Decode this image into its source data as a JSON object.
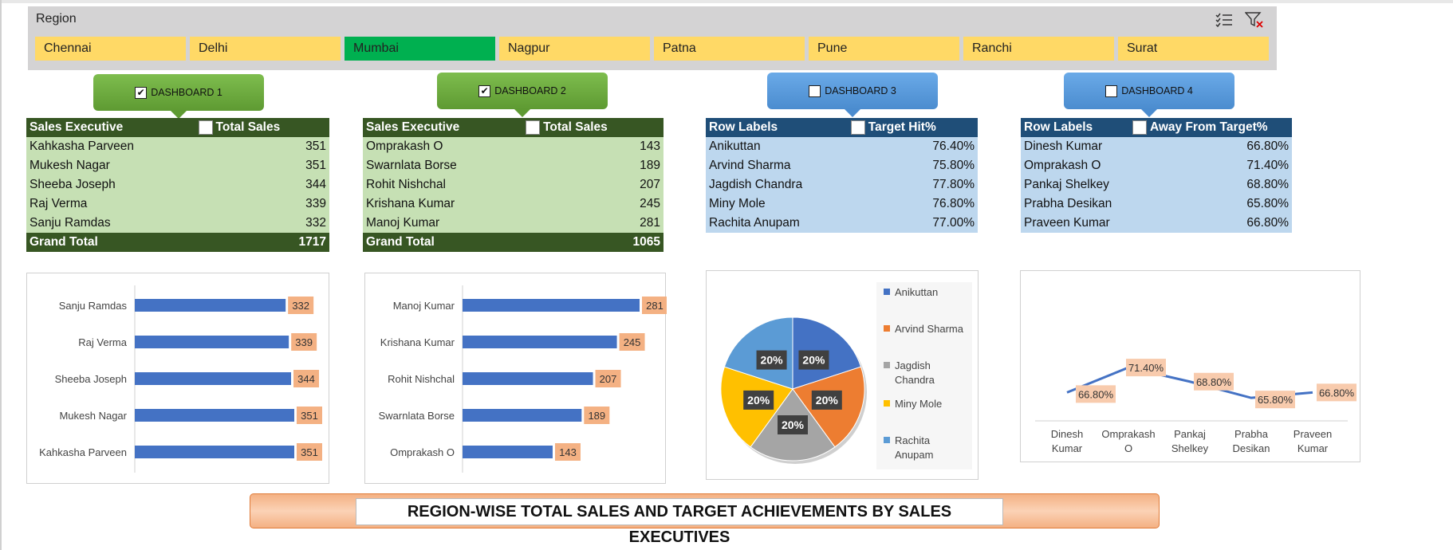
{
  "slicer": {
    "title": "Region",
    "items": [
      "Chennai",
      "Delhi",
      "Mumbai",
      "Nagpur",
      "Patna",
      "Pune",
      "Ranchi",
      "Surat"
    ],
    "selected": "Mumbai"
  },
  "dashboards": [
    {
      "label": "DASHBOARD 1",
      "checked": true
    },
    {
      "label": "DASHBOARD 2",
      "checked": true
    },
    {
      "label": "DASHBOARD 3",
      "checked": false
    },
    {
      "label": "DASHBOARD 4",
      "checked": false
    }
  ],
  "table1": {
    "headers": [
      "Sales Executive",
      "Total Sales"
    ],
    "rows": [
      [
        "Kahkasha Parveen",
        "351"
      ],
      [
        "Mukesh Nagar",
        "351"
      ],
      [
        "Sheeba Joseph",
        "344"
      ],
      [
        "Raj Verma",
        "339"
      ],
      [
        "Sanju Ramdas",
        "332"
      ]
    ],
    "total": [
      "Grand Total",
      "1717"
    ]
  },
  "table2": {
    "headers": [
      "Sales Executive",
      "Total Sales"
    ],
    "rows": [
      [
        "Omprakash O",
        "143"
      ],
      [
        "Swarnlata Borse",
        "189"
      ],
      [
        "Rohit Nishchal",
        "207"
      ],
      [
        "Krishana Kumar",
        "245"
      ],
      [
        "Manoj Kumar",
        "281"
      ]
    ],
    "total": [
      "Grand Total",
      "1065"
    ]
  },
  "table3": {
    "headers": [
      "Row Labels",
      "Target Hit%"
    ],
    "rows": [
      [
        "Anikuttan",
        "76.40%"
      ],
      [
        "Arvind Sharma",
        "75.80%"
      ],
      [
        "Jagdish Chandra",
        "77.80%"
      ],
      [
        "Miny Mole",
        "76.80%"
      ],
      [
        "Rachita Anupam",
        "77.00%"
      ]
    ]
  },
  "table4": {
    "headers": [
      "Row Labels",
      "Away From Target%"
    ],
    "rows": [
      [
        "Dinesh Kumar",
        "66.80%"
      ],
      [
        "Omprakash O",
        "71.40%"
      ],
      [
        "Pankaj Shelkey",
        "68.80%"
      ],
      [
        "Prabha Desikan",
        "65.80%"
      ],
      [
        "Praveen Kumar",
        "66.80%"
      ]
    ]
  },
  "chart_data": [
    {
      "type": "bar",
      "orientation": "horizontal",
      "categories": [
        "Sanju Ramdas",
        "Raj Verma",
        "Sheeba Joseph",
        "Mukesh Nagar",
        "Kahkasha Parveen"
      ],
      "values": [
        332,
        339,
        344,
        351,
        351
      ],
      "color": "#4472c4",
      "label_bg": "#f4b183"
    },
    {
      "type": "bar",
      "orientation": "horizontal",
      "categories": [
        "Manoj Kumar",
        "Krishana Kumar",
        "Rohit Nishchal",
        "Swarnlata Borse",
        "Omprakash O"
      ],
      "values": [
        281,
        245,
        207,
        189,
        143
      ],
      "color": "#4472c4",
      "label_bg": "#f4b183"
    },
    {
      "type": "pie",
      "categories": [
        "Anikuttan",
        "Arvind Sharma",
        "Jagdish Chandra",
        "Miny Mole",
        "Rachita Anupam"
      ],
      "values": [
        20,
        20,
        20,
        20,
        20
      ],
      "labels": [
        "20%",
        "20%",
        "20%",
        "20%",
        "20%"
      ],
      "colors": [
        "#4472c4",
        "#ed7d31",
        "#a5a5a5",
        "#ffc000",
        "#5b9bd5"
      ],
      "legend": "right"
    },
    {
      "type": "line",
      "categories": [
        "Dinesh Kumar",
        "Omprakash O",
        "Pankaj Shelkey",
        "Prabha Desikan",
        "Praveen Kumar"
      ],
      "values": [
        66.8,
        71.4,
        68.8,
        65.8,
        66.8
      ],
      "labels": [
        "66.80%",
        "71.40%",
        "68.80%",
        "65.80%",
        "66.80%"
      ],
      "color": "#4472c4",
      "label_bg": "#f8cbad"
    }
  ],
  "banner": {
    "title": "REGION-WISE TOTAL SALES AND TARGET ACHIEVEMENTS BY SALES EXECUTIVES"
  }
}
